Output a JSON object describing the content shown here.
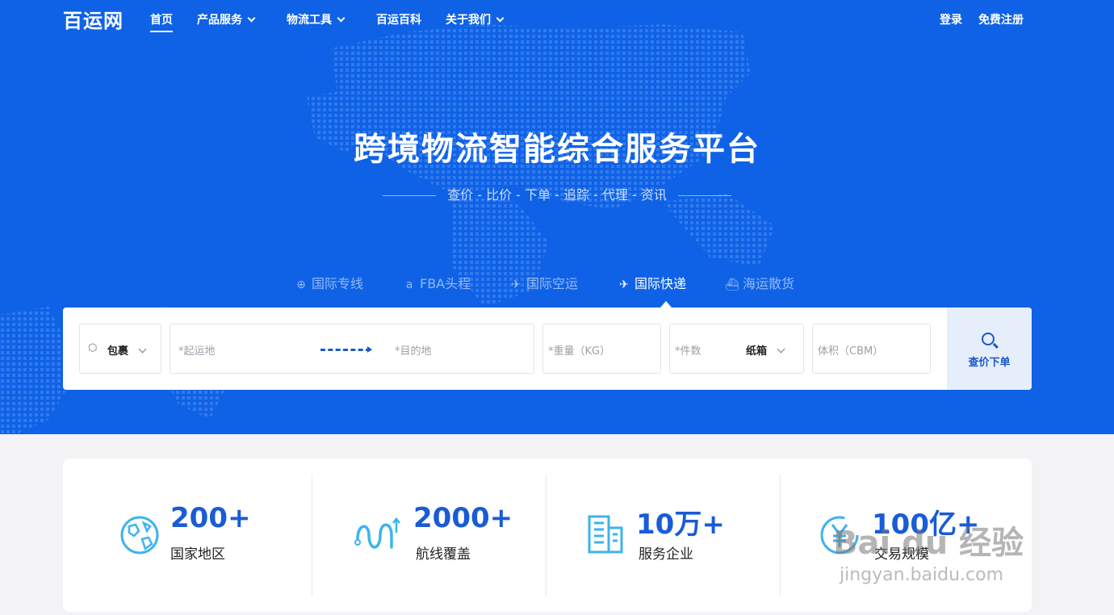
{
  "brand": {
    "logo": "百运网"
  },
  "nav": {
    "items": [
      {
        "label": "首页",
        "active": true,
        "dropdown": false
      },
      {
        "label": "产品服务",
        "active": false,
        "dropdown": true
      },
      {
        "label": "物流工具",
        "active": false,
        "dropdown": true
      },
      {
        "label": "百运百科",
        "active": false,
        "dropdown": false
      },
      {
        "label": "关于我们",
        "active": false,
        "dropdown": true
      }
    ],
    "login": "登录",
    "register": "免费注册"
  },
  "hero": {
    "title": "跨境物流智能综合服务平台",
    "subtitle": "查价 - 比价 - 下单 - 追踪 - 代理 - 资讯"
  },
  "tabs": [
    {
      "label": "国际专线",
      "icon": "globe-icon",
      "active": false
    },
    {
      "label": "FBA头程",
      "icon": "amazon-icon",
      "active": false
    },
    {
      "label": "国际空运",
      "icon": "plane-box-icon",
      "active": false
    },
    {
      "label": "国际快递",
      "icon": "plane-icon",
      "active": true
    },
    {
      "label": "海运散货",
      "icon": "ship-icon",
      "active": false
    }
  ],
  "search": {
    "package_type": "包裹",
    "origin_placeholder": "*起运地",
    "destination_placeholder": "*目的地",
    "weight_placeholder": "*重量（KG）",
    "pieces_placeholder": "*件数",
    "pack_type": "纸箱",
    "volume_placeholder": "体积（CBM）",
    "submit_label": "查价下单"
  },
  "stats": [
    {
      "value": "200+",
      "label": "国家地区",
      "icon": "globe-icon"
    },
    {
      "value": "2000+",
      "label": "航线覆盖",
      "icon": "route-icon"
    },
    {
      "value": "10万+",
      "label": "服务企业",
      "icon": "building-icon"
    },
    {
      "value": "100亿+",
      "label": "交易规模",
      "icon": "yen-icon"
    }
  ],
  "watermark": {
    "brand": "Bai du 经验",
    "url": "jingyan.baidu.com"
  },
  "colors": {
    "primary": "#0f62e6",
    "accent": "#1a5bd6",
    "icon": "#3db3ef"
  }
}
